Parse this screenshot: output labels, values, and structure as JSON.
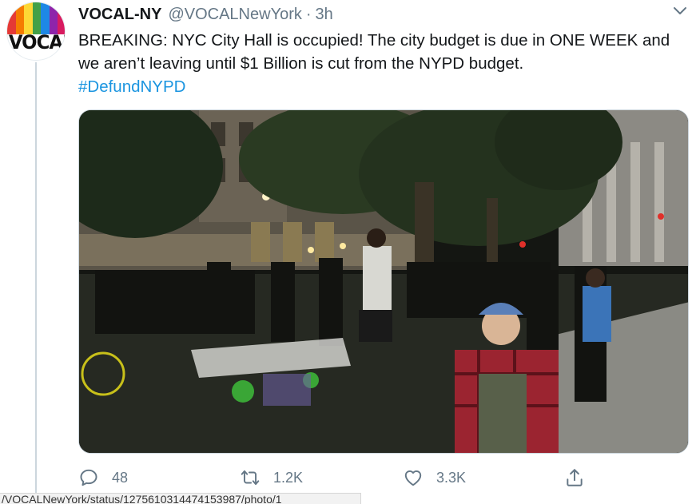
{
  "tweet": {
    "display_name": "VOCAL-NY",
    "handle": "@VOCALNewYork",
    "separator": "·",
    "time": "3h",
    "text_main": "BREAKING: NYC City Hall is occupied! The city budget is due in ONE WEEK and we aren’t leaving until $1 Billion is cut from the NYPD budget.",
    "hashtag": "#DefundNYPD",
    "avatar": {
      "logo_text": "VOCAL",
      "stripe_colors": [
        "#e53935",
        "#f57c00",
        "#fdd835",
        "#43a047",
        "#1e88e5",
        "#8e24aa",
        "#d81b60"
      ]
    },
    "photo": {
      "alt": "Protesters at night in City Hall Park"
    }
  },
  "actions": {
    "reply": {
      "icon": "reply-icon",
      "count": "48"
    },
    "retweet": {
      "icon": "retweet-icon",
      "count": "1.2K"
    },
    "like": {
      "icon": "heart-icon",
      "count": "3.3K"
    },
    "share": {
      "icon": "share-icon"
    }
  },
  "status_bar": {
    "url": "/VOCALNewYork/status/1275610314474153987/photo/1"
  },
  "colors": {
    "link": "#1b95e0",
    "secondary": "#657786",
    "thread_line": "#ccd6dd"
  }
}
